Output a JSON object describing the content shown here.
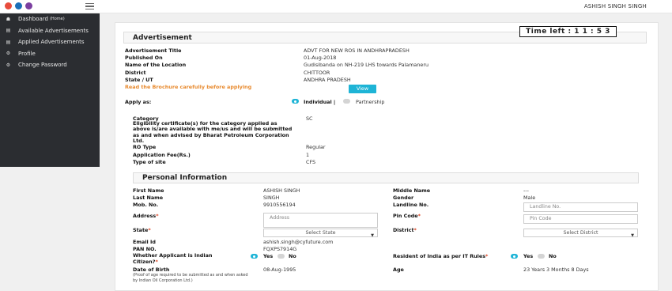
{
  "header": {
    "username": "ASHISH SINGH SINGH",
    "colors": {
      "logo1": "#e84c3d",
      "logo2": "#1b6fb8",
      "logo3": "#7b3fa0"
    }
  },
  "sidebar": {
    "items": [
      {
        "label": "Dashboard",
        "sub": "(Home)",
        "icon": "home-icon"
      },
      {
        "label": "Available Advertisements",
        "icon": "list-icon"
      },
      {
        "label": "Applied Advertisements",
        "icon": "list-icon"
      },
      {
        "label": "Profile",
        "icon": "gear-icon"
      },
      {
        "label": "Change Password",
        "icon": "gear-icon"
      }
    ]
  },
  "timer": {
    "label": "Time left :",
    "value": "1 1 : 5 3"
  },
  "advertisement": {
    "title": "Advertisement",
    "fields": [
      {
        "label": "Advertisement Title",
        "value": "ADVT FOR NEW ROS IN ANDHRAPRADESH"
      },
      {
        "label": "Published On",
        "value": "01-Aug-2018"
      },
      {
        "label": "Name of the Location",
        "value": "Gudisibanda on NH-219 LHS towards Palamaneru"
      },
      {
        "label": "District",
        "value": "CHITTOOR"
      },
      {
        "label": "State / UT",
        "value": "ANDHRA PRADESH"
      }
    ],
    "brochure_note": "Read the Brochure carefully before applying",
    "view_label": "View",
    "apply_as_label": "Apply as:",
    "apply_individual": "Individual |",
    "apply_partnership": "Partnership"
  },
  "category": {
    "category_label": "Category",
    "category_value": "SC",
    "eligibility_label": "Eligibility certificate(s) for the category applied as above is/are available with me/us and will be submitted as and when advised by Bharat Petroleum Corporation Ltd.",
    "ro_type_label": "RO Type",
    "ro_type_value": "Regular",
    "fee_label": "Application Fee(Rs.)",
    "fee_value": "1",
    "site_label": "Type of site",
    "site_value": "CFS"
  },
  "personal": {
    "title": "Personal Information",
    "first_name_label": "First Name",
    "first_name": "ASHISH SINGH",
    "middle_name_label": "Middle Name",
    "middle_name": "---",
    "last_name_label": "Last Name",
    "last_name": "SINGH",
    "gender_label": "Gender",
    "gender": "Male",
    "mobile_label": "Mob. No.",
    "mobile": "9910556194",
    "landline_label": "Landline No.",
    "landline_placeholder": "Landline No.",
    "address_label": "Address",
    "address_placeholder": "Address",
    "pincode_label": "Pin Code",
    "pincode_placeholder": "Pin Code",
    "state_label": "State",
    "state_select": "Select State",
    "district_label": "District",
    "district_select": "Select District",
    "email_label": "Email Id",
    "email": "ashish.singh@cyfuture.com",
    "pan_label": "PAN NO.",
    "pan": "FQXPS7914G",
    "indian_label": "Whether Applicant is Indian Citizen?",
    "yes": "Yes",
    "no": "No",
    "resident_label": "Resident of India as per IT Rules",
    "dob_label": "Date of Birth",
    "dob_note": "(Proof of age required to be submitted as and when asked by Indian Oil Corporation Ltd.)",
    "dob": "08-Aug-1995",
    "age_label": "Age",
    "age": "23 Years 3 Months 8 Days"
  }
}
